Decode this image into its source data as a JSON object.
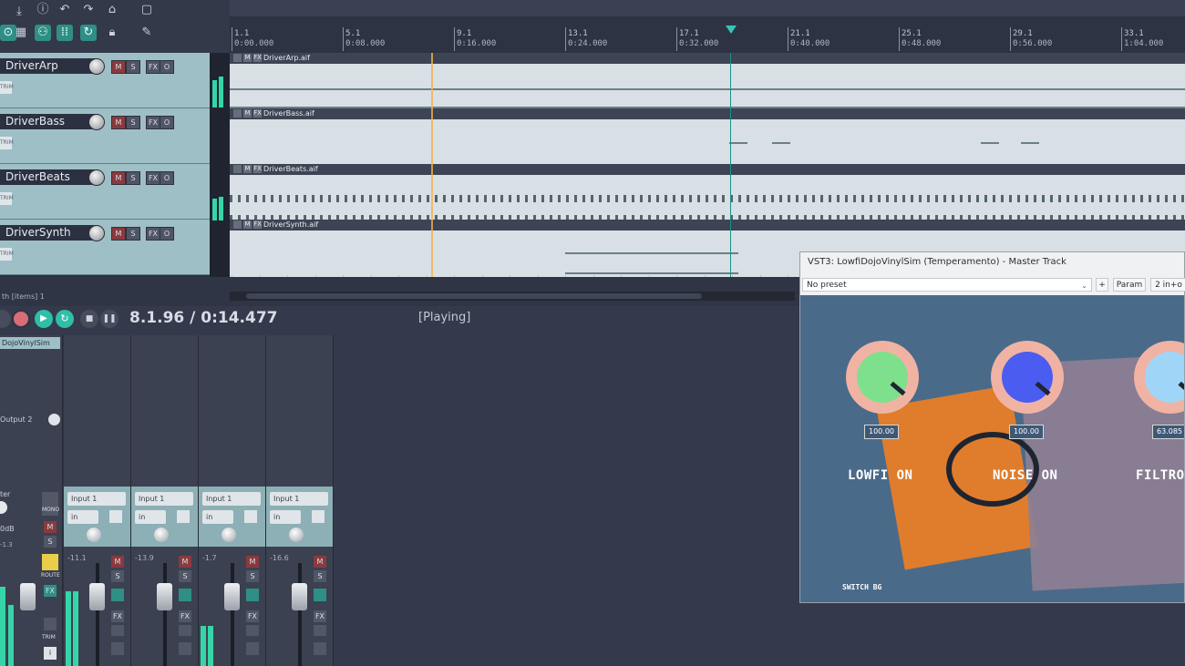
{
  "toolbar": {
    "icons": [
      "download-icon",
      "info-icon",
      "undo-icon",
      "redo-icon",
      "metronome-icon",
      "snap-icon",
      "grid-icon",
      "grid-dots-icon",
      "loop-icon",
      "lock-icon",
      "pencil-icon"
    ]
  },
  "ruler": {
    "marks": [
      {
        "measure": "1.1",
        "time": "0:00.000"
      },
      {
        "measure": "5.1",
        "time": "0:08.000"
      },
      {
        "measure": "9.1",
        "time": "0:16.000"
      },
      {
        "measure": "13.1",
        "time": "0:24.000"
      },
      {
        "measure": "17.1",
        "time": "0:32.000"
      },
      {
        "measure": "21.1",
        "time": "0:40.000"
      },
      {
        "measure": "25.1",
        "time": "0:48.000"
      },
      {
        "measure": "29.1",
        "time": "0:56.000"
      },
      {
        "measure": "33.1",
        "time": "1:04.000"
      }
    ]
  },
  "tracks": [
    {
      "name": "DriverArp",
      "clip": "DriverArp.aif",
      "mute": "M",
      "solo": "S",
      "fx": "FX",
      "io": "O",
      "trim": "TRIM"
    },
    {
      "name": "DriverBass",
      "clip": "DriverBass.aif",
      "mute": "M",
      "solo": "S",
      "fx": "FX",
      "io": "O",
      "trim": "TRIM"
    },
    {
      "name": "DriverBeats",
      "clip": "DriverBeats.aif",
      "mute": "M",
      "solo": "S",
      "fx": "FX",
      "io": "O",
      "trim": "TRIM"
    },
    {
      "name": "DriverSynth",
      "clip": "DriverSynth.aif",
      "mute": "M",
      "solo": "S",
      "fx": "FX",
      "io": "O",
      "trim": "TRIM"
    }
  ],
  "status": {
    "selection": "th [items] 1"
  },
  "transport": {
    "position": "8.1.96 / 0:14.477",
    "state": "[Playing]"
  },
  "mixer": {
    "master": {
      "fx_name": "DojoVinylSim",
      "output": "Output 2",
      "label": "ter",
      "db": "0dB",
      "peak": "-1.3",
      "mono": "MONO",
      "route": "ROUTE",
      "trim": "TRIM"
    },
    "strips": [
      {
        "input": "Input 1",
        "in": "in",
        "db": "-11.1"
      },
      {
        "input": "Input 1",
        "in": "in",
        "db": "-13.9"
      },
      {
        "input": "Input 1",
        "in": "in",
        "db": "-1.7"
      },
      {
        "input": "Input 1",
        "in": "in",
        "db": "-16.6"
      }
    ],
    "buttons": {
      "m": "M",
      "s": "S",
      "fx": "FX"
    }
  },
  "plugin": {
    "title": "VST3: LowfiDojoVinylSim (Temperamento) - Master Track",
    "preset": "No preset",
    "plus": "+",
    "param": "Param",
    "io": "2 in+o",
    "knobs": [
      {
        "value": "100.00",
        "label": "LOWFI ON",
        "color": "#7ee08c"
      },
      {
        "value": "100.00",
        "label": "NOISE ON",
        "color": "#4b5cf0"
      },
      {
        "value": "63.085",
        "label": "FILTRO",
        "color": "#9fd6f7"
      }
    ],
    "switch_bg": "SWITCH BG"
  },
  "colors": {
    "accent": "#2f8f86",
    "meter": "#35d5a8",
    "track_bg": "#9fbfc6"
  }
}
